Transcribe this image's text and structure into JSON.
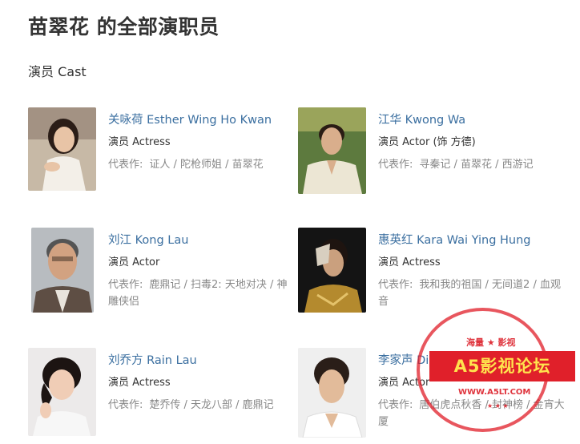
{
  "page": {
    "title": "苗翠花 的全部演职员"
  },
  "section": {
    "title": "演员 Cast"
  },
  "cast": [
    {
      "name": "关咏荷 Esther Wing Ho Kwan",
      "role": "演员 Actress",
      "works_label": "代表作:",
      "works": "证人 / 陀枪师姐 / 苗翠花"
    },
    {
      "name": "江华 Kwong Wa",
      "role": "演员 Actor (饰 方德)",
      "works_label": "代表作:",
      "works": "寻秦记 / 苗翠花 / 西游记"
    },
    {
      "name": "刘江 Kong Lau",
      "role": "演员 Actor",
      "works_label": "代表作:",
      "works": "鹿鼎记 / 扫毒2: 天地对决 / 神雕侠侣"
    },
    {
      "name": "惠英红 Kara Wai Ying Hung",
      "role": "演员 Actress",
      "works_label": "代表作:",
      "works": "我和我的祖国 / 无间道2 / 血观音"
    },
    {
      "name": "刘乔方 Rain Lau",
      "role": "演员 Actress",
      "works_label": "代表作:",
      "works": "楚乔传 / 天龙八部 / 鹿鼎记"
    },
    {
      "name": "李家声 Dickson Lee Kar-Sing",
      "role": "演员 Actor",
      "works_label": "代表作:",
      "works": "唐伯虎点秋香 / 封神榜 / 金宵大厦"
    }
  ],
  "watermark": {
    "top_text": "海量 ★ 影视",
    "banner": "A5影视论坛",
    "url": "WWW.A5LT.COM",
    "stars": "★ ★ ★",
    "colors": {
      "red": "#e0202a",
      "yellow": "#ffe34d"
    }
  },
  "colors": {
    "link": "#3b6fa0",
    "text": "#333333",
    "muted": "#888888"
  }
}
